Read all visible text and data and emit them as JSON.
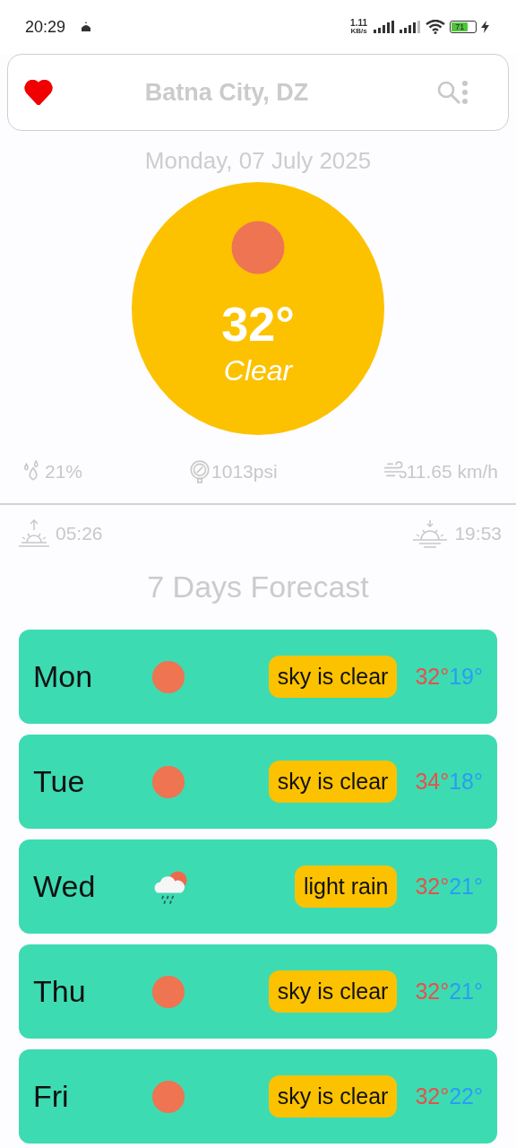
{
  "status_bar": {
    "time": "20:29",
    "speed_value": "1.11",
    "speed_unit": "KB/s",
    "battery": "71"
  },
  "header": {
    "city": "Batna City, DZ",
    "favorite": true
  },
  "date": "Monday, 07 July 2025",
  "current": {
    "temperature": "32°",
    "condition": "Clear",
    "kind": "sun"
  },
  "stats": [
    {
      "kind": "humidity",
      "value": "21%"
    },
    {
      "kind": "pressure",
      "value": "1013psi"
    },
    {
      "kind": "wind",
      "value": "11.65 km/h"
    }
  ],
  "sun": {
    "sunrise": "05:26",
    "sunset": "19:53"
  },
  "forecast_title": "7 Days Forecast",
  "forecast": [
    {
      "day": "Mon",
      "kind": "sun",
      "description": "sky is clear",
      "high": "32°",
      "low": "19°"
    },
    {
      "day": "Tue",
      "kind": "sun",
      "description": "sky is clear",
      "high": "34°",
      "low": "18°"
    },
    {
      "day": "Wed",
      "kind": "rain",
      "description": "light rain",
      "high": "32°",
      "low": "21°"
    },
    {
      "day": "Thu",
      "kind": "sun",
      "description": "sky is clear",
      "high": "32°",
      "low": "21°"
    },
    {
      "day": "Fri",
      "kind": "sun",
      "description": "sky is clear",
      "high": "32°",
      "low": "22°"
    }
  ]
}
